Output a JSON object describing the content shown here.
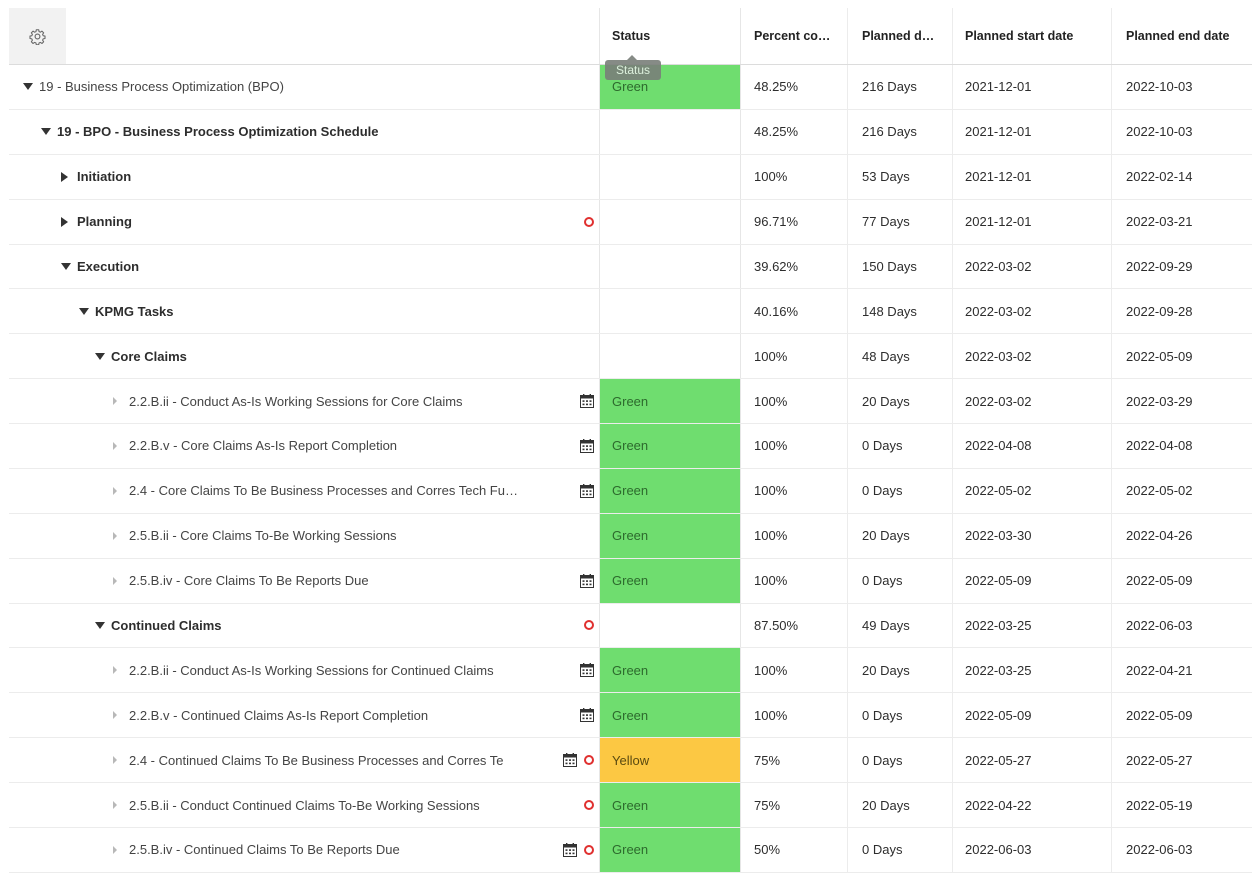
{
  "header": {
    "gear_icon": "gear-icon",
    "columns": [
      "Status",
      "Percent co…",
      "Planned d…",
      "Planned start date",
      "Planned end date"
    ]
  },
  "tooltip": "Status",
  "colors": {
    "green": "#6fdd6f",
    "yellow": "#fcc843",
    "warning_dot": "#e0302f"
  },
  "rows": [
    {
      "name": "19 - Business Process Optimization (BPO)",
      "status": "Green",
      "percent": "48.25%",
      "duration": "216 Days",
      "start": "2021-12-01",
      "end": "2022-10-03"
    },
    {
      "name": "19 - BPO - Business Process Optimization Schedule",
      "status": "",
      "percent": "48.25%",
      "duration": "216 Days",
      "start": "2021-12-01",
      "end": "2022-10-03"
    },
    {
      "name": "Initiation",
      "status": "",
      "percent": "100%",
      "duration": "53 Days",
      "start": "2021-12-01",
      "end": "2022-02-14"
    },
    {
      "name": "Planning",
      "status": "",
      "percent": "96.71%",
      "duration": "77 Days",
      "start": "2021-12-01",
      "end": "2022-03-21"
    },
    {
      "name": "Execution",
      "status": "",
      "percent": "39.62%",
      "duration": "150 Days",
      "start": "2022-03-02",
      "end": "2022-09-29"
    },
    {
      "name": "KPMG Tasks",
      "status": "",
      "percent": "40.16%",
      "duration": "148 Days",
      "start": "2022-03-02",
      "end": "2022-09-28"
    },
    {
      "name": "Core Claims",
      "status": "",
      "percent": "100%",
      "duration": "48 Days",
      "start": "2022-03-02",
      "end": "2022-05-09"
    },
    {
      "name": "2.2.B.ii - Conduct As-Is Working Sessions for Core Claims",
      "status": "Green",
      "percent": "100%",
      "duration": "20 Days",
      "start": "2022-03-02",
      "end": "2022-03-29"
    },
    {
      "name": "2.2.B.v - Core Claims As-Is Report Completion",
      "status": "Green",
      "percent": "100%",
      "duration": "0 Days",
      "start": "2022-04-08",
      "end": "2022-04-08"
    },
    {
      "name": "2.4 - Core Claims To Be Business Processes and Corres Tech Fu…",
      "status": "Green",
      "percent": "100%",
      "duration": "0 Days",
      "start": "2022-05-02",
      "end": "2022-05-02"
    },
    {
      "name": "2.5.B.ii - Core Claims To-Be Working Sessions",
      "status": "Green",
      "percent": "100%",
      "duration": "20 Days",
      "start": "2022-03-30",
      "end": "2022-04-26"
    },
    {
      "name": "2.5.B.iv - Core Claims To Be Reports Due",
      "status": "Green",
      "percent": "100%",
      "duration": "0 Days",
      "start": "2022-05-09",
      "end": "2022-05-09"
    },
    {
      "name": "Continued Claims",
      "status": "",
      "percent": "87.50%",
      "duration": "49 Days",
      "start": "2022-03-25",
      "end": "2022-06-03"
    },
    {
      "name": "2.2.B.ii - Conduct As-Is Working Sessions for Continued Claims",
      "status": "Green",
      "percent": "100%",
      "duration": "20 Days",
      "start": "2022-03-25",
      "end": "2022-04-21"
    },
    {
      "name": "2.2.B.v - Continued Claims As-Is Report Completion",
      "status": "Green",
      "percent": "100%",
      "duration": "0 Days",
      "start": "2022-05-09",
      "end": "2022-05-09"
    },
    {
      "name": "2.4 - Continued Claims To Be Business Processes and Corres Te",
      "status": "Yellow",
      "percent": "75%",
      "duration": "0 Days",
      "start": "2022-05-27",
      "end": "2022-05-27"
    },
    {
      "name": "2.5.B.ii - Conduct Continued Claims To-Be Working Sessions",
      "status": "Green",
      "percent": "75%",
      "duration": "20 Days",
      "start": "2022-04-22",
      "end": "2022-05-19"
    },
    {
      "name": "2.5.B.iv - Continued Claims To Be Reports Due",
      "status": "Green",
      "percent": "50%",
      "duration": "0 Days",
      "start": "2022-06-03",
      "end": "2022-06-03"
    }
  ]
}
